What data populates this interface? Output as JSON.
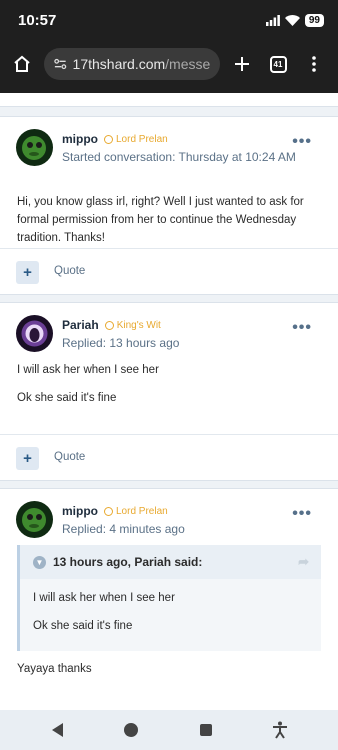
{
  "status": {
    "time": "10:57",
    "battery": "99"
  },
  "browser": {
    "url_host": "17thshard.com",
    "url_path": "/messeng",
    "tab_count": "41"
  },
  "posts": [
    {
      "author": "mippo",
      "rank": "Lord Prelan",
      "meta": "Started conversation: Thursday at 10:24 AM",
      "paragraphs": [
        "Hi, you know glass irl, right? Well I just wanted to ask for formal permission from her to continue the Wednesday tradition. Thanks!"
      ],
      "quote_label": "Quote"
    },
    {
      "author": "Pariah",
      "rank": "King's Wit",
      "meta": "Replied: 13 hours ago",
      "paragraphs": [
        "I will ask her when I see her",
        "Ok she said it's fine"
      ],
      "quote_label": "Quote"
    },
    {
      "author": "mippo",
      "rank": "Lord Prelan",
      "meta": "Replied: 4 minutes ago",
      "quote": {
        "header": "13 hours ago, Pariah said:",
        "paragraphs": [
          "I will ask her when I see her",
          "Ok she said it's fine"
        ]
      },
      "paragraphs": [
        "Yayaya thanks"
      ]
    }
  ],
  "colors": {
    "rank": "#e8a92f",
    "meta": "#5b7187",
    "accent": "#2a5a86"
  }
}
